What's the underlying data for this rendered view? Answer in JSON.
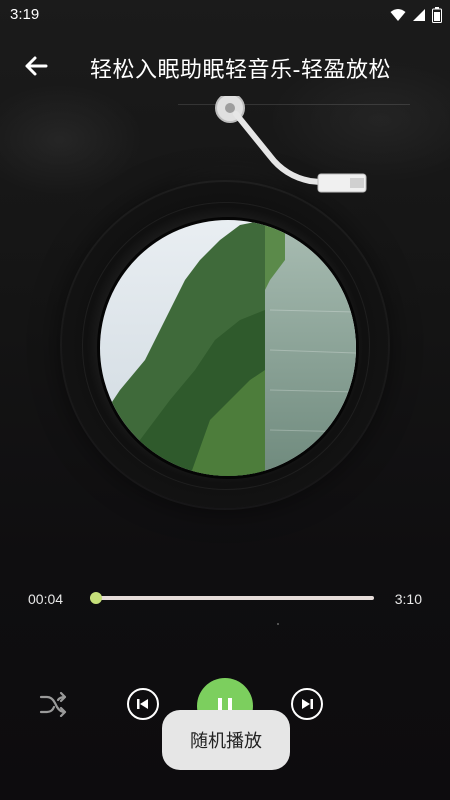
{
  "status_bar": {
    "time": "3:19"
  },
  "header": {
    "title": "轻松入眠助眠轻音乐-轻盈放松"
  },
  "player": {
    "current_time": "00:04",
    "total_time": "3:10",
    "progress_fraction": 0.02
  },
  "toast": {
    "text": "随机播放"
  },
  "colors": {
    "accent": "#7ccf5e",
    "thumb": "#c6e07a",
    "track": "#e6dcd9",
    "toast_bg": "#e6e6e6"
  },
  "icons": {
    "back": "arrow-left-icon",
    "shuffle": "shuffle-icon",
    "prev": "skip-previous-icon",
    "play": "pause-icon",
    "next": "skip-next-icon"
  }
}
